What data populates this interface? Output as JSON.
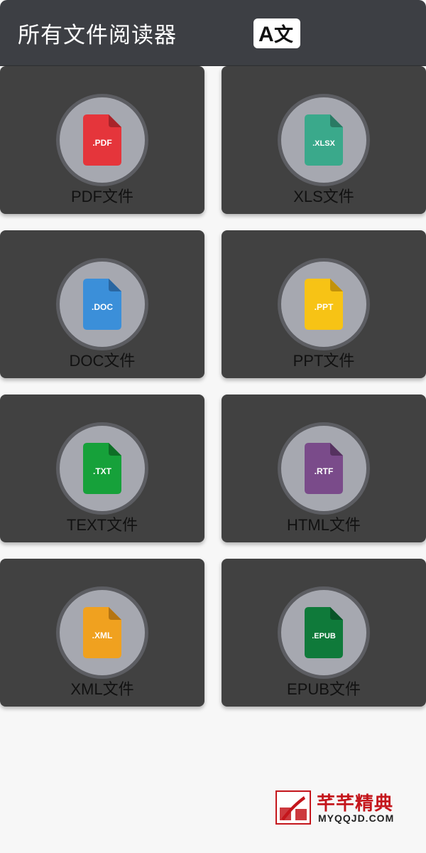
{
  "app_bar": {
    "title": "所有文件阅读器",
    "translate_button": {
      "icon": "translate-icon",
      "glyph_a": "A",
      "glyph_b": "文"
    }
  },
  "files": [
    {
      "id": "pdf",
      "label": "PDF文件",
      "ext": ".PDF",
      "color": "#e5353b",
      "fold": "#a8242a"
    },
    {
      "id": "xls",
      "label": "XLS文件",
      "ext": ".XLSX",
      "color": "#3aa98b",
      "fold": "#2a7a64"
    },
    {
      "id": "doc",
      "label": "DOC文件",
      "ext": ".DOC",
      "color": "#3b8fd9",
      "fold": "#2a66a0"
    },
    {
      "id": "ppt",
      "label": "PPT文件",
      "ext": ".PPT",
      "color": "#f7c315",
      "fold": "#c2920a"
    },
    {
      "id": "text",
      "label": "TEXT文件",
      "ext": ".TXT",
      "color": "#16a13a",
      "fold": "#0e6e26"
    },
    {
      "id": "html",
      "label": "HTML文件",
      "ext": ".RTF",
      "color": "#7a4b8a",
      "fold": "#55325f"
    },
    {
      "id": "xml",
      "label": "XML文件",
      "ext": ".XML",
      "color": "#f0a11f",
      "fold": "#b57512"
    },
    {
      "id": "epub",
      "label": "EPUB文件",
      "ext": ".EPUB",
      "color": "#0f7a3a",
      "fold": "#0a5428"
    }
  ],
  "watermark": {
    "title": "芊芊精典",
    "url": "MYQQJD.COM"
  }
}
